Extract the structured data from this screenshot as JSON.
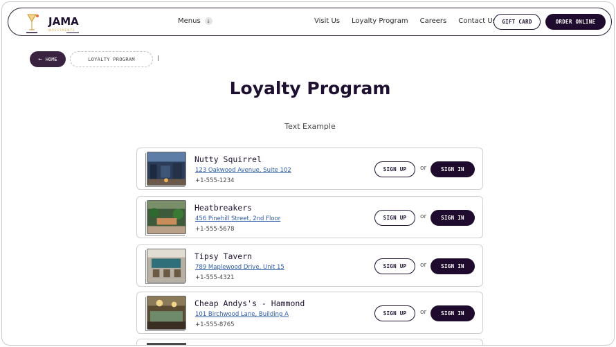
{
  "header": {
    "logo_text": "JAMA",
    "logo_sub": "INVESTMENTS",
    "menus_label": "Menus",
    "nav": [
      "Visit Us",
      "Loyalty Program",
      "Careers",
      "Contact Us"
    ],
    "gift_card": "GIFT CARD",
    "order_online": "ORDER ONLINE"
  },
  "breadcrumb": {
    "home": "HOME",
    "current": "LOYALTY PROGRAM"
  },
  "page": {
    "title": "Loyalty Program",
    "subtitle": "Text Example"
  },
  "restaurants": [
    {
      "name": "Nutty Squirrel",
      "address": "123 Oakwood Avenue, Suite 102",
      "phone": "+1-555-1234",
      "sign_up": "SIGN UP",
      "or": "or",
      "sign_in": "SIGN IN"
    },
    {
      "name": "Heatbreakers",
      "address": "456 Pinehill Street, 2nd Floor",
      "phone": "+1-555-5678",
      "sign_up": "SIGN UP",
      "or": "or",
      "sign_in": "SIGN IN"
    },
    {
      "name": "Tipsy Tavern",
      "address": "789 Maplewood Drive, Unit 15",
      "phone": "+1-555-4321",
      "sign_up": "SIGN UP",
      "or": "or",
      "sign_in": "SIGN IN"
    },
    {
      "name": "Cheap Andys's - Hammond",
      "address": "101 Birchwood Lane, Building A",
      "phone": "+1-555-8765",
      "sign_up": "SIGN UP",
      "or": "or",
      "sign_in": "SIGN IN"
    }
  ],
  "colors": {
    "brand_dark": "#1e0b2e",
    "link": "#2a5aa8",
    "logo_gold": "#d9a441"
  },
  "icons": {
    "menus_dropdown": "chevron-down-icon",
    "home_back": "arrow-left-icon"
  }
}
